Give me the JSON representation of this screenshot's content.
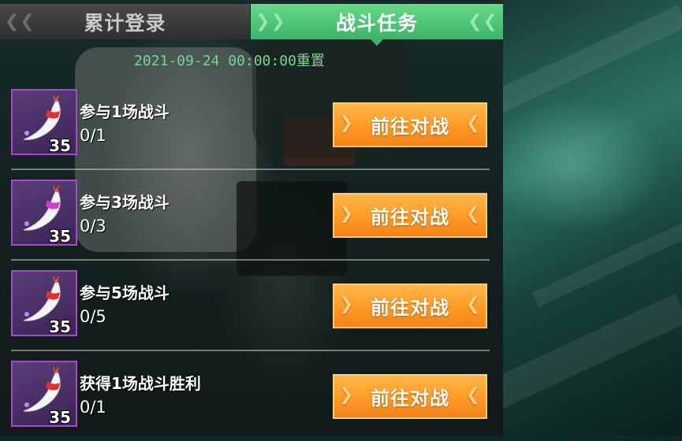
{
  "tabs": {
    "login_label": "累计登录",
    "battle_label": "战斗任务"
  },
  "reset_text": "2021-09-24 00:00:00重置",
  "tasks": [
    {
      "title": "参与1场战斗",
      "progress": "0/1",
      "reward_count": "35",
      "button_label": "前往对战"
    },
    {
      "title": "参与3场战斗",
      "progress": "0/3",
      "reward_count": "35",
      "button_label": "前往对战"
    },
    {
      "title": "参与5场战斗",
      "progress": "0/5",
      "reward_count": "35",
      "button_label": "前往对战"
    },
    {
      "title": "获得1场战斗胜利",
      "progress": "0/1",
      "reward_count": "35",
      "button_label": "前往对战"
    }
  ],
  "colors": {
    "active_tab": "#3bb465",
    "button": "#ff9a26",
    "reset_text": "#7bd48f",
    "item_border": "#a54bc4"
  },
  "icons": [
    "tooth-charm-icon",
    "chevron-left-icon",
    "chevron-right-icon"
  ]
}
